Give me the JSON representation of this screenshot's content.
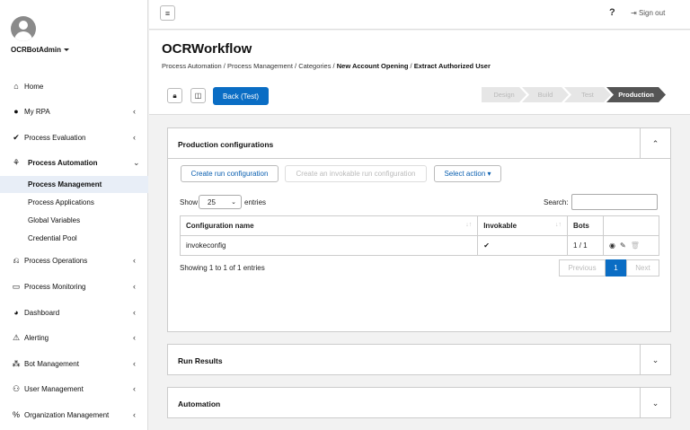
{
  "user": {
    "name": "OCRBotAdmin"
  },
  "sidebar": {
    "items": [
      {
        "label": "Home",
        "icon": "home-icon",
        "glyph": "⌂"
      },
      {
        "label": "My RPA",
        "icon": "person-icon",
        "glyph": "●"
      },
      {
        "label": "Process Evaluation",
        "icon": "check-icon",
        "glyph": "✔"
      },
      {
        "label": "Process Automation",
        "icon": "sitemap-icon",
        "glyph": "⚘"
      },
      {
        "label": "Process Operations",
        "icon": "operations-icon",
        "glyph": "⎌"
      },
      {
        "label": "Process Monitoring",
        "icon": "monitor-icon",
        "glyph": "▭"
      },
      {
        "label": "Dashboard",
        "icon": "piechart-icon",
        "glyph": "◕"
      },
      {
        "label": "Alerting",
        "icon": "warning-icon",
        "glyph": "⚠"
      },
      {
        "label": "Bot Management",
        "icon": "bot-icon",
        "glyph": "⁂"
      },
      {
        "label": "User Management",
        "icon": "users-icon",
        "glyph": "⚇"
      },
      {
        "label": "Organization Management",
        "icon": "org-icon",
        "glyph": "%"
      }
    ],
    "subitems": [
      {
        "label": "Process Management"
      },
      {
        "label": "Process Applications"
      },
      {
        "label": "Global Variables"
      },
      {
        "label": "Credential Pool"
      }
    ]
  },
  "topbar": {
    "help": "?",
    "signout": "Sign out"
  },
  "page": {
    "title": "OCRWorkflow",
    "breadcrumb": [
      "Process Automation",
      "Process Management",
      "Categories",
      "New Account Opening",
      "Extract Authorized User"
    ]
  },
  "toolbar": {
    "back_label": "Back (Test)"
  },
  "steps": [
    "Design",
    "Build",
    "Test",
    "Production"
  ],
  "prod": {
    "title": "Production configurations",
    "create_btn": "Create run configuration",
    "create_invokable_btn": "Create an invokable run configuration",
    "select_action": "Select action",
    "show_label": "Show",
    "entries_value": "25",
    "entries_label": "entries",
    "search_label": "Search:",
    "search_value": "",
    "columns": [
      "Configuration name",
      "Invokable",
      "Bots"
    ],
    "rows": [
      {
        "name": "invokeconfig",
        "invokable": "✔",
        "bots": "1 / 1"
      }
    ],
    "showing": "Showing 1 to 1 of 1 entries",
    "pager": {
      "prev": "Previous",
      "page": "1",
      "next": "Next"
    }
  },
  "run_results": {
    "title": "Run Results"
  },
  "automation": {
    "title": "Automation"
  },
  "colors": {
    "accent": "#0a6dc4",
    "active_step": "#555555",
    "selected_nav_bg": "#e8eef7"
  }
}
